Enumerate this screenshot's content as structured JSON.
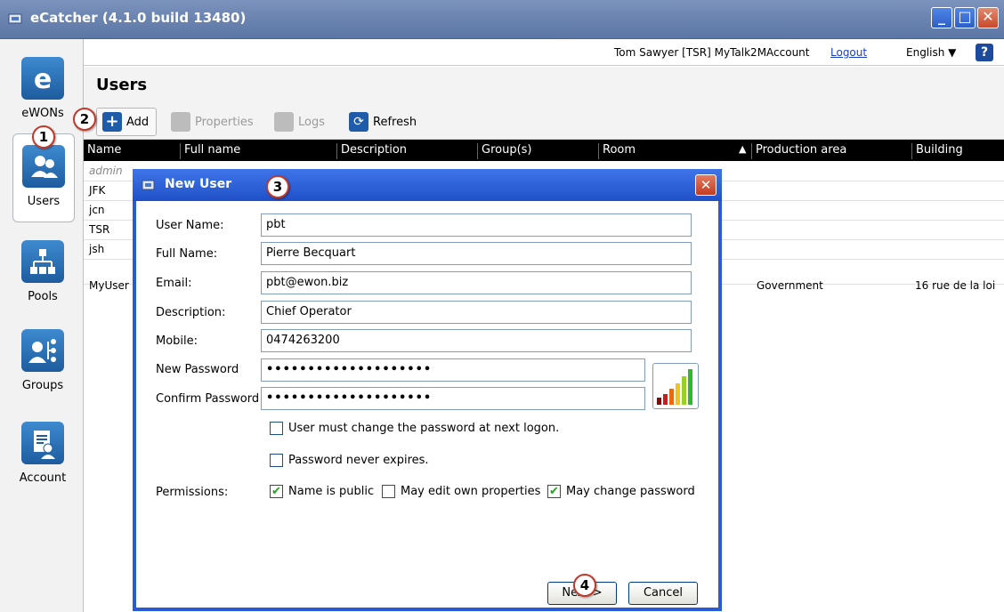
{
  "window": {
    "title": "eCatcher (4.1.0 build 13480)"
  },
  "nav": {
    "items": [
      {
        "label": "eWONs"
      },
      {
        "label": "Users"
      },
      {
        "label": "Pools"
      },
      {
        "label": "Groups"
      },
      {
        "label": "Account"
      }
    ]
  },
  "topbar": {
    "user": "Tom Sawyer [TSR] MyTalk2MAccount",
    "logout": "Logout",
    "language": "English ▼",
    "help": "?"
  },
  "page": {
    "title": "Users"
  },
  "toolbar": {
    "add": "Add",
    "properties": "Properties",
    "logs": "Logs",
    "refresh": "Refresh"
  },
  "table": {
    "columns": [
      "Name",
      "Full name",
      "Description",
      "Group(s)",
      "Room",
      "Production area",
      "Building"
    ],
    "rows": [
      {
        "name": "admin",
        "production_area": "",
        "building": ""
      },
      {
        "name": "JFK",
        "production_area": "",
        "building": ""
      },
      {
        "name": "jcn",
        "production_area": "",
        "building": ""
      },
      {
        "name": "TSR",
        "production_area": "",
        "building": ""
      },
      {
        "name": "jsh",
        "production_area": "",
        "building": ""
      },
      {
        "name": "MyUser",
        "production_area": "Government",
        "building": "16 rue de la loi"
      }
    ]
  },
  "callouts": [
    "1",
    "2",
    "3",
    "4"
  ],
  "dialog": {
    "title": "New User",
    "fields": {
      "username_label": "User Name:",
      "username": "pbt",
      "fullname_label": "Full Name:",
      "fullname": "Pierre Becquart",
      "email_label": "Email:",
      "email": "pbt@ewon.biz",
      "description_label": "Description:",
      "description": "Chief Operator",
      "mobile_label": "Mobile:",
      "mobile": "0474263200",
      "newpw_label": "New Password",
      "newpw": "••••••••••••••••••••",
      "confirmpw_label": "Confirm Password",
      "confirmpw": "••••••••••••••••••••"
    },
    "options": {
      "must_change": "User must change the password at next logon.",
      "never_expires": "Password never expires."
    },
    "permissions": {
      "label": "Permissions:",
      "name_public": "Name is public",
      "edit_own": "May edit own properties",
      "change_password": "May change password"
    },
    "buttons": {
      "next": "Next >",
      "cancel": "Cancel"
    }
  }
}
